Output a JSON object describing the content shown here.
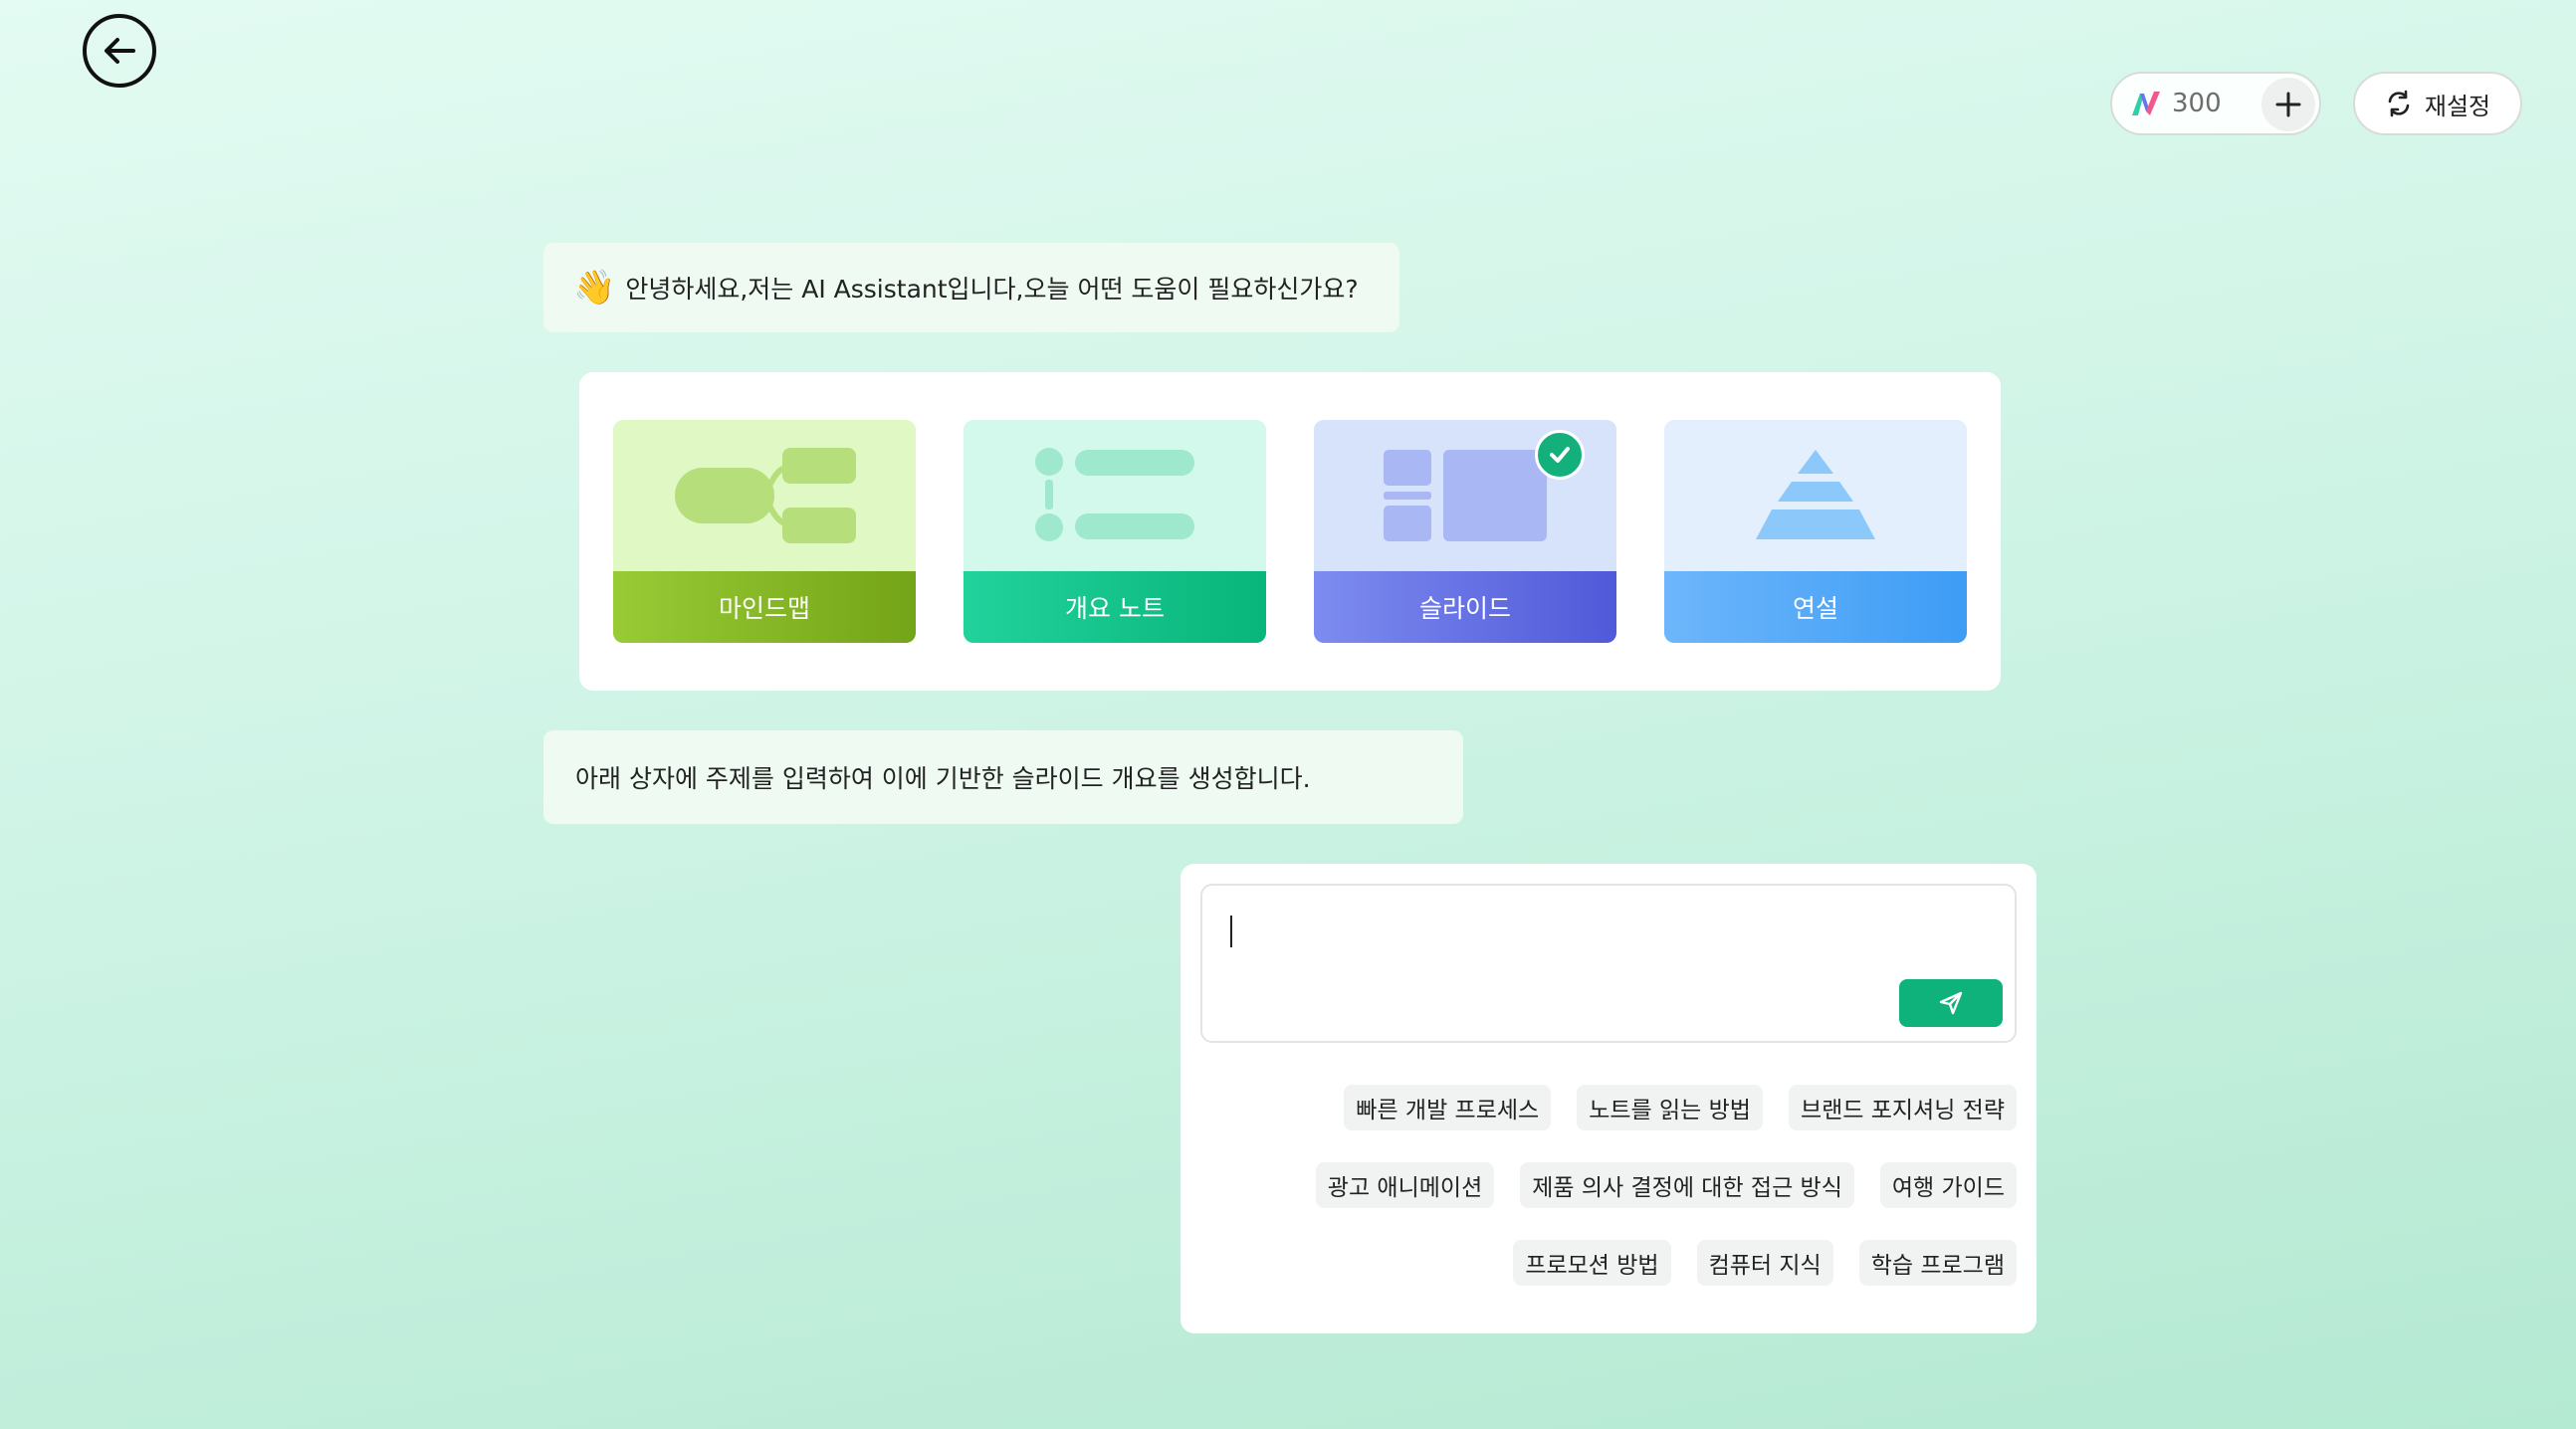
{
  "header": {
    "credits": "300",
    "reset_label": "재설정"
  },
  "assistant": {
    "greeting": "안녕하세요,저는 AI Assistant입니다,오늘 어떤 도움이 필요하신가요?",
    "greeting_emoji": "👋",
    "instruction": "아래 상자에 주제를 입력하여 이에 기반한 슬라이드 개요를 생성합니다."
  },
  "types": [
    {
      "label": "마인드맵",
      "icon": "mindmap-icon"
    },
    {
      "label": "개요 노트",
      "icon": "outline-icon"
    },
    {
      "label": "슬라이드",
      "icon": "slides-icon",
      "selected": true
    },
    {
      "label": "연설",
      "icon": "pyramid-icon"
    }
  ],
  "composer": {
    "value": "",
    "suggestions": [
      [
        "빠른 개발 프로세스",
        "노트를 읽는 방법",
        "브랜드 포지셔닝 전략"
      ],
      [
        "광고 애니메이션",
        "제품 의사 결정에 대한 접근 방식",
        "여행 가이드"
      ],
      [
        "프로모션 방법",
        "컴퓨터 지식",
        "학습 프로그램"
      ]
    ]
  },
  "colors": {
    "accent": "#0fb27b",
    "mindmap": "#98cb36",
    "outline": "#08b57a",
    "slides": "#5e68e0",
    "speech": "#3d9cf5"
  }
}
